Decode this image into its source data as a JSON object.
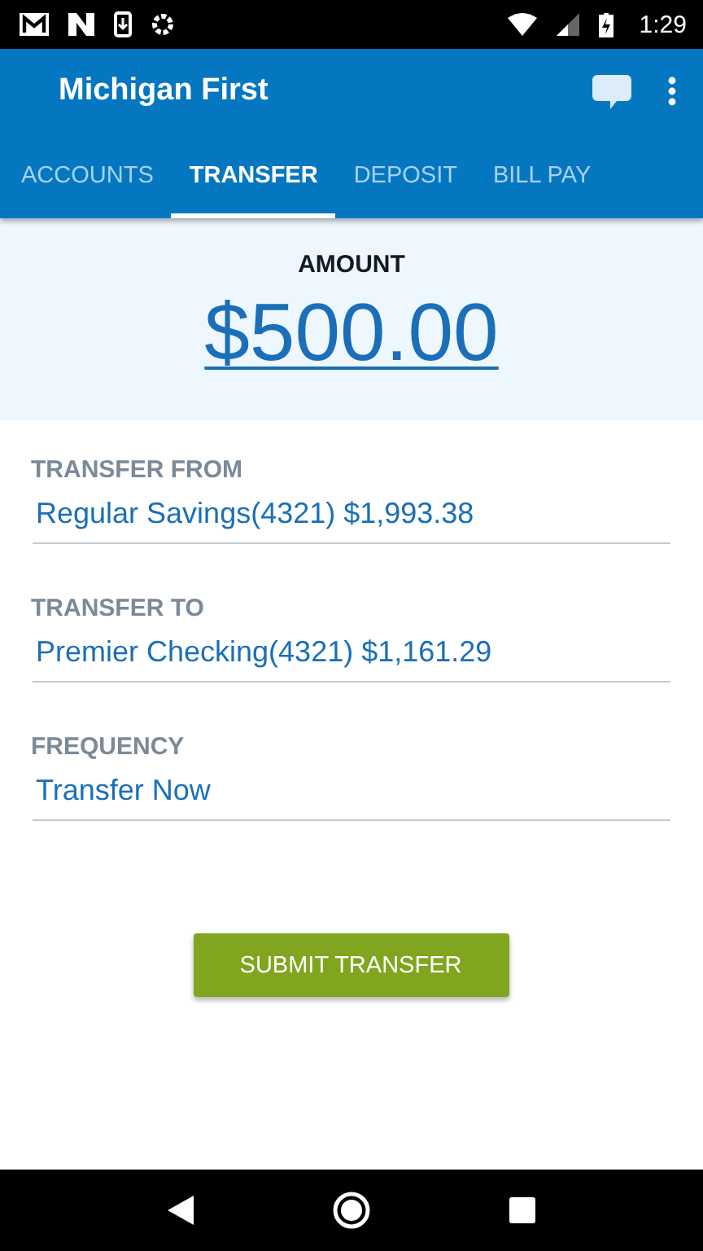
{
  "status_bar": {
    "time": "1:29"
  },
  "app_bar": {
    "title": "Michigan First"
  },
  "tabs": [
    {
      "label": "ACCOUNTS",
      "selected": false
    },
    {
      "label": "TRANSFER",
      "selected": true
    },
    {
      "label": "DEPOSIT",
      "selected": false
    },
    {
      "label": "BILL PAY",
      "selected": false
    }
  ],
  "amount": {
    "label": "AMOUNT",
    "value": "$500.00"
  },
  "fields": [
    {
      "label": "TRANSFER FROM",
      "value": "Regular Savings(4321) $1,993.38"
    },
    {
      "label": "TRANSFER TO",
      "value": "Premier Checking(4321) $1,161.29"
    },
    {
      "label": "FREQUENCY",
      "value": "Transfer Now"
    }
  ],
  "submit_button": "SUBMIT TRANSFER"
}
